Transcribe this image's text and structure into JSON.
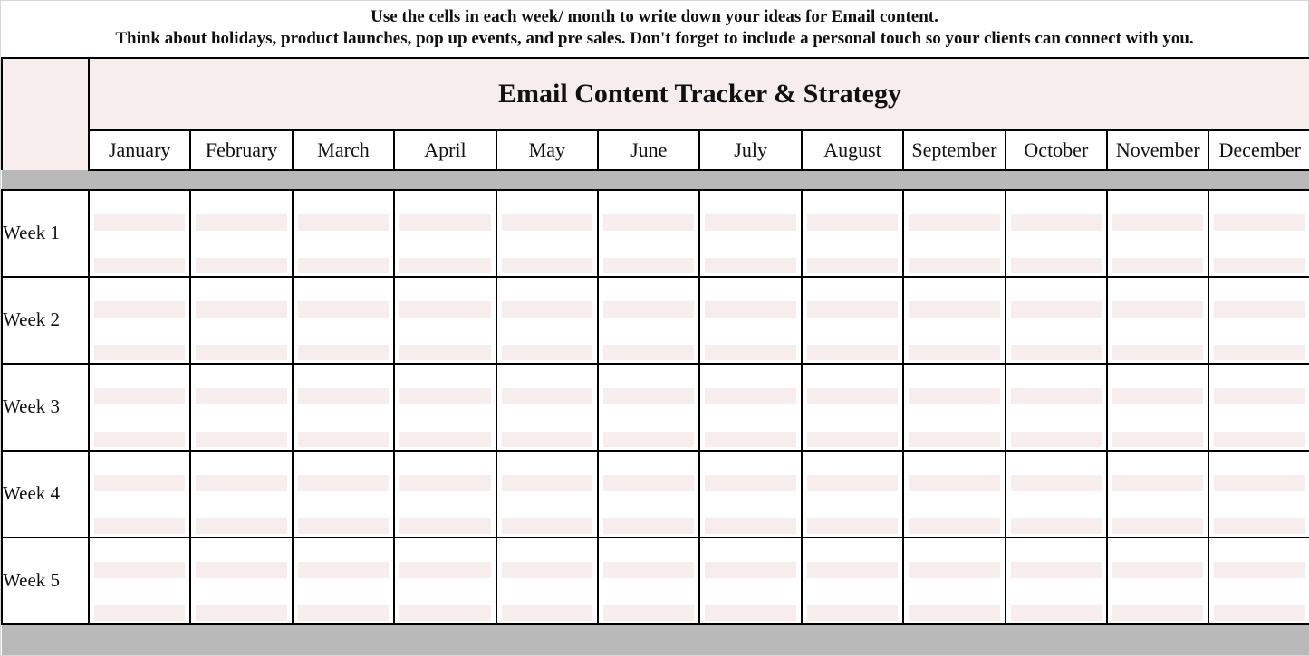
{
  "instructions": {
    "line1": "Use the cells in each week/ month to write down your ideas for Email content.",
    "line2": "Think about holidays, product launches, pop up events, and pre sales. Don't forget to include a personal touch so your clients can connect with you."
  },
  "title": "Email Content Tracker & Strategy",
  "months": [
    "January",
    "February",
    "March",
    "April",
    "May",
    "June",
    "July",
    "August",
    "September",
    "October",
    "November",
    "December"
  ],
  "weeks": [
    "Week 1",
    "Week 2",
    "Week 3",
    "Week 4",
    "Week 5"
  ],
  "rows_per_week": 4,
  "cells": {}
}
